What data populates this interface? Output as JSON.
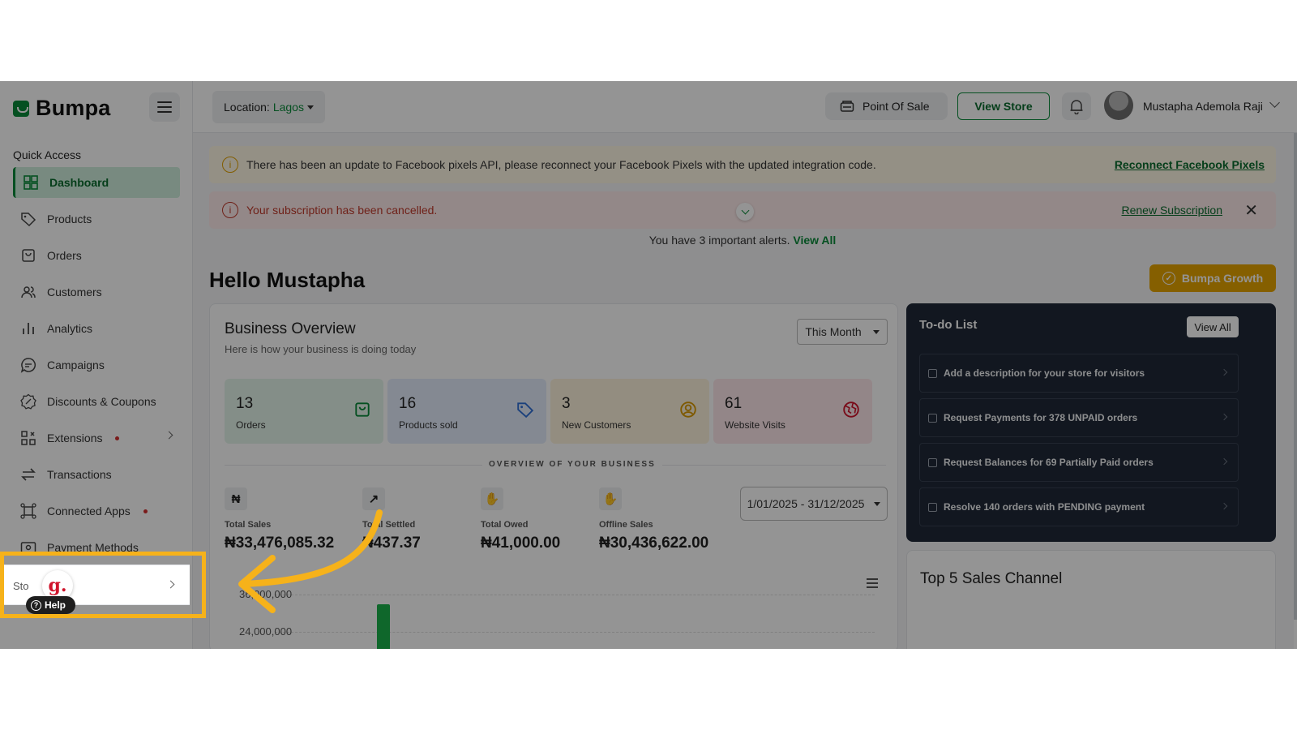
{
  "colors": {
    "brand": "#0a8a3a",
    "accent_yellow": "#e6a400",
    "highlight": "#f6b21a",
    "dark_panel": "#1f2937"
  },
  "sidebar": {
    "logo": "Bumpa",
    "quick_access_title": "Quick Access",
    "items": [
      {
        "label": "Dashboard",
        "icon": "grid-icon",
        "active": true
      },
      {
        "label": "Products",
        "icon": "tag-icon"
      },
      {
        "label": "Orders",
        "icon": "bag-icon"
      },
      {
        "label": "Customers",
        "icon": "users-icon"
      },
      {
        "label": "Analytics",
        "icon": "bar-chart-icon"
      },
      {
        "label": "Campaigns",
        "icon": "chat-icon"
      },
      {
        "label": "Discounts & Coupons",
        "icon": "discount-icon"
      },
      {
        "label": "Extensions",
        "icon": "extensions-icon",
        "dot": true,
        "chevron": true
      },
      {
        "label": "Transactions",
        "icon": "transfer-icon"
      },
      {
        "label": "Connected Apps",
        "icon": "apps-icon",
        "dot": true
      },
      {
        "label": "Payment Methods",
        "icon": "money-icon"
      }
    ],
    "store_label": "Sto",
    "g_badge": "g.",
    "help_label": "Help"
  },
  "topbar": {
    "location_label": "Location:",
    "location_value": "Lagos",
    "pos_label": "Point Of Sale",
    "view_store_label": "View Store",
    "user_name": "Mustapha Ademola Raji"
  },
  "alerts": {
    "facebook_text": "There has been an update to Facebook pixels API, please reconnect your Facebook Pixels with the updated integration code.",
    "facebook_link": "Reconnect Facebook Pixels",
    "subscription_text": "Your subscription has been cancelled.",
    "subscription_link": "Renew Subscription",
    "summary_text": "You have 3 important alerts.",
    "summary_link": "View All"
  },
  "main": {
    "greeting": "Hello Mustapha",
    "growth_label": "Bumpa Growth"
  },
  "overview": {
    "title": "Business Overview",
    "subtitle": "Here is how your business is doing today",
    "period": "This Month",
    "stats": [
      {
        "value": "13",
        "label": "Orders",
        "icon": "bag-icon",
        "bg": "#e4f4ea"
      },
      {
        "value": "16",
        "label": "Products sold",
        "icon": "tag-icon",
        "bg": "#e4edfb"
      },
      {
        "value": "3",
        "label": "New Customers",
        "icon": "user-circle-icon",
        "bg": "#fdf3dc"
      },
      {
        "value": "61",
        "label": "Website Visits",
        "icon": "globe-icon",
        "bg": "#fde7ea"
      }
    ],
    "section_label": "OVERVIEW OF YOUR BUSINESS",
    "metrics": [
      {
        "label": "Total Sales",
        "value": "₦33,476,085.32",
        "icon": "naira-icon",
        "glyph": "₦"
      },
      {
        "label": "Total Settled",
        "value": "₦437.37",
        "icon": "trend-icon",
        "glyph": "↗"
      },
      {
        "label": "Total Owed",
        "value": "₦41,000.00",
        "icon": "hand-coin-icon",
        "glyph": "✋"
      },
      {
        "label": "Offline Sales",
        "value": "₦30,436,622.00",
        "icon": "hand-coin-icon",
        "glyph": "✋"
      }
    ],
    "date_range": "1/01/2025 - 31/12/2025",
    "chart_ticks": [
      "36,000,000",
      "24,000,000"
    ]
  },
  "todo": {
    "title": "To-do List",
    "view_all": "View All",
    "items": [
      "Add a description for your store for visitors",
      "Request Payments for 378 UNPAID orders",
      "Request Balances for 69 Partially Paid orders",
      "Resolve 140 orders with PENDING payment"
    ]
  },
  "top5": {
    "title": "Top 5 Sales Channel"
  }
}
